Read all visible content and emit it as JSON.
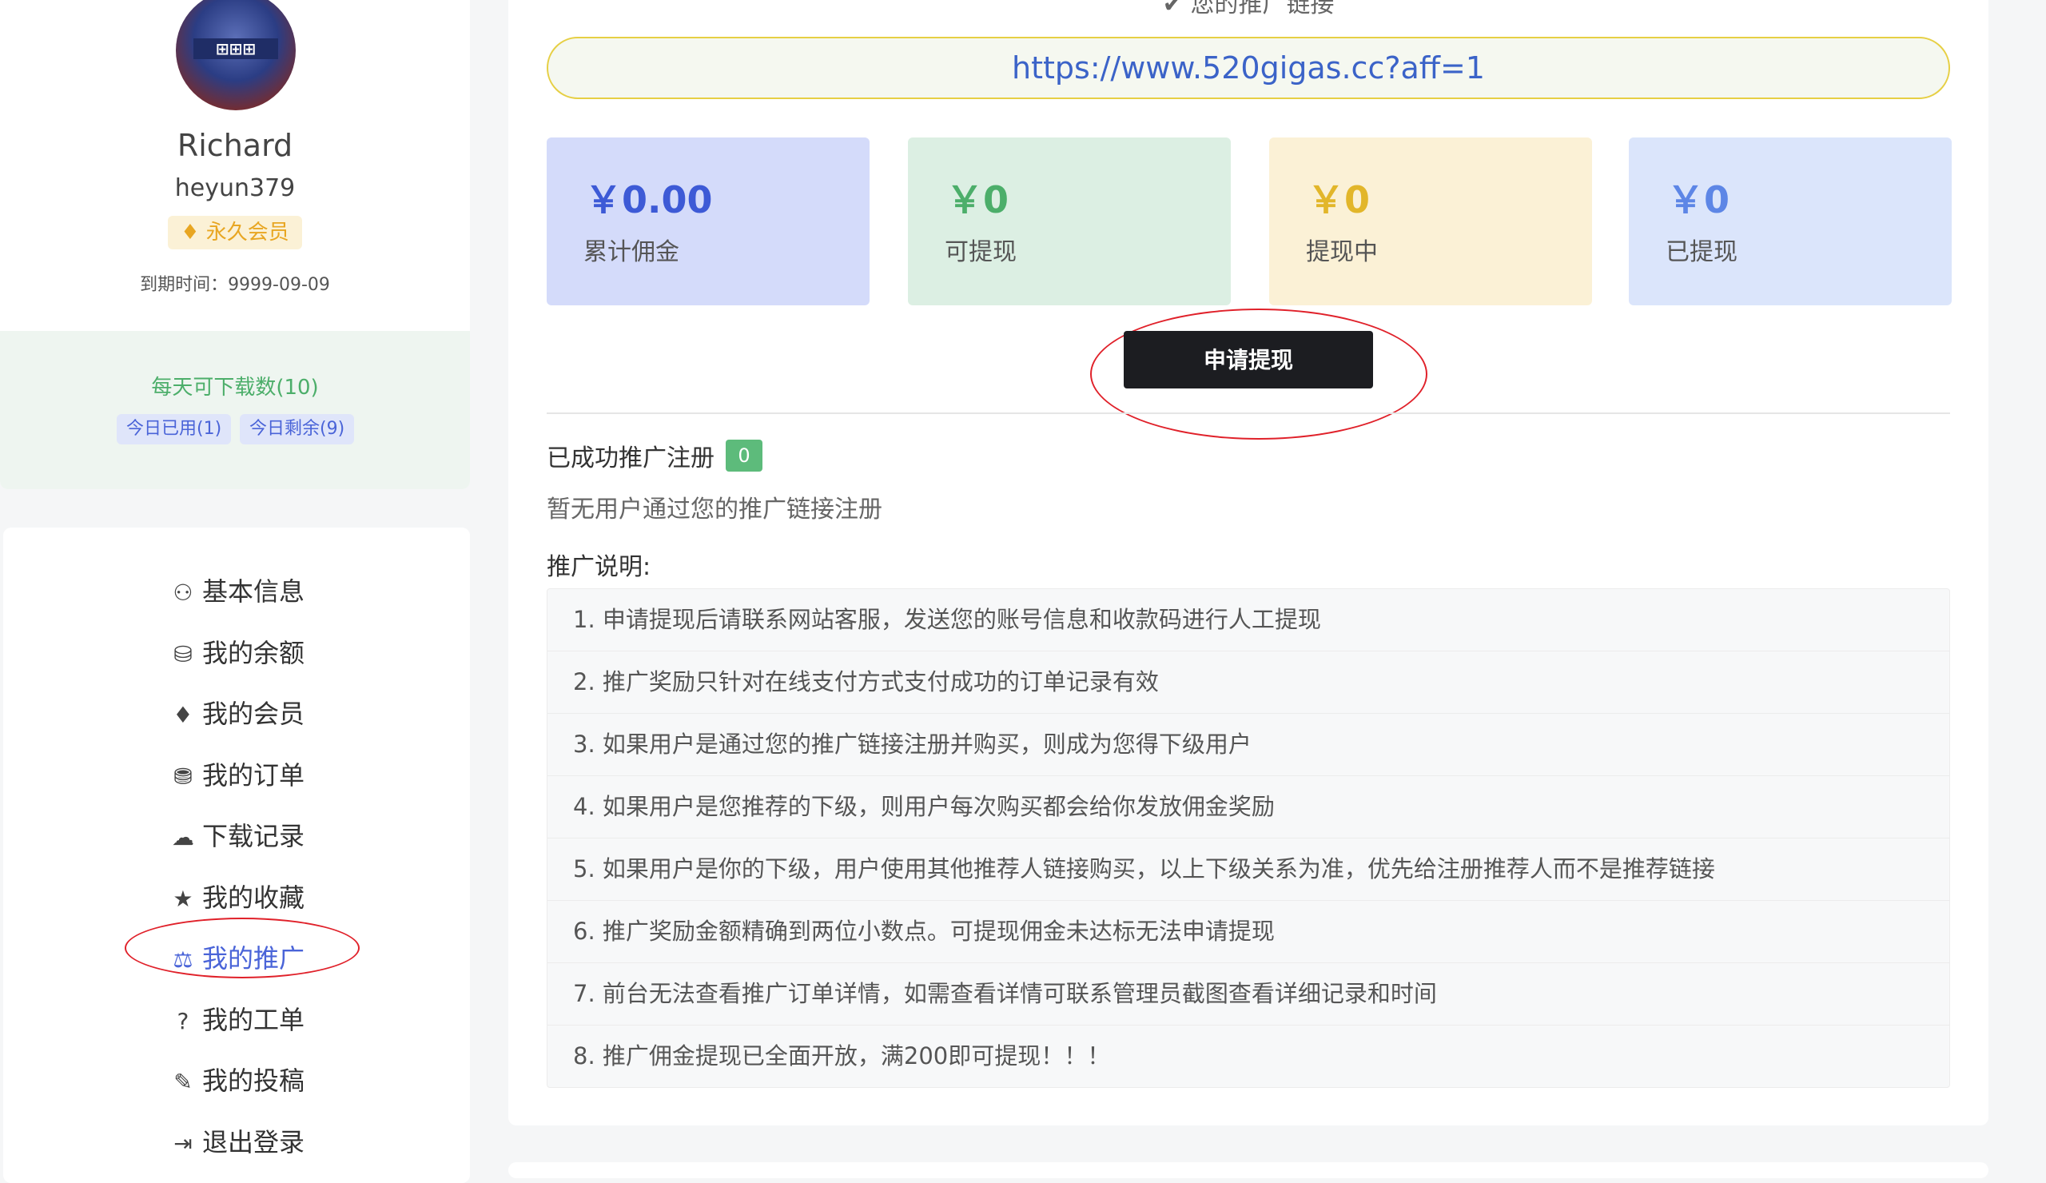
{
  "profile": {
    "name": "Richard",
    "handle": "heyun379",
    "vip_label": "永久会员",
    "expire_text": "到期时间：9999-09-09"
  },
  "quota": {
    "title": "每天可下载数(10)",
    "used": "今日已用(1)",
    "remaining": "今日剩余(9)"
  },
  "menu": {
    "items": [
      {
        "label": "基本信息",
        "icon": "user-icon"
      },
      {
        "label": "我的余额",
        "icon": "coins-icon"
      },
      {
        "label": "我的会员",
        "icon": "diamond-icon"
      },
      {
        "label": "我的订单",
        "icon": "shopping-bag-icon"
      },
      {
        "label": "下载记录",
        "icon": "cloud-download-icon"
      },
      {
        "label": "我的收藏",
        "icon": "star-icon"
      },
      {
        "label": "我的推广",
        "icon": "hand-holding-dollar-icon"
      },
      {
        "label": "我的工单",
        "icon": "question-circle-icon"
      },
      {
        "label": "我的投稿",
        "icon": "edit-icon"
      },
      {
        "label": "退出登录",
        "icon": "sign-out-icon"
      }
    ],
    "active_index": 6
  },
  "main": {
    "link_heading": "您的推广链接",
    "aff_link": "https://www.520gigas.cc?aff=1",
    "stats": [
      {
        "amount": "￥0.00",
        "label": "累计佣金",
        "bg": "#d4dbfa",
        "color": "#3d5ad6"
      },
      {
        "amount": "￥0",
        "label": "可提现",
        "bg": "#dcefe3",
        "color": "#4cae6a"
      },
      {
        "amount": "￥0",
        "label": "提现中",
        "bg": "#fbf1d6",
        "color": "#e2b62a"
      },
      {
        "amount": "￥0",
        "label": "已提现",
        "bg": "#dbe5fb",
        "color": "#5d86e6"
      }
    ],
    "apply_button": "申请提现",
    "reg_title": "已成功推广注册",
    "reg_count": "0",
    "reg_empty": "暂无用户通过您的推广链接注册",
    "rules_title": "推广说明:",
    "rules": [
      "1. 申请提现后请联系网站客服，发送您的账号信息和收款码进行人工提现",
      "2. 推广奖励只针对在线支付方式支付成功的订单记录有效",
      "3. 如果用户是通过您的推广链接注册并购买，则成为您得下级用户",
      "4. 如果用户是您推荐的下级，则用户每次购买都会给你发放佣金奖励",
      "5. 如果用户是你的下级，用户使用其他推荐人链接购买，以上下级关系为准，优先给注册推荐人而不是推荐链接",
      "6. 推广奖励金额精确到两位小数点。可提现佣金未达标无法申请提现",
      "7. 前台无法查看推广订单详情，如需查看详情可联系管理员截图查看详细记录和时间",
      "8. 推广佣金提现已全面开放，满200即可提现！！！"
    ]
  }
}
